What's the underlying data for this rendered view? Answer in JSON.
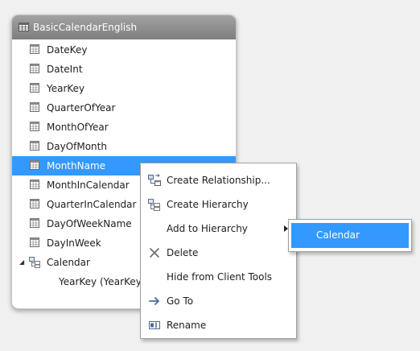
{
  "table": {
    "title": "BasicCalendarEnglish",
    "header_icon": "table-icon",
    "columns": [
      {
        "label": "DateKey",
        "icon": "column-icon"
      },
      {
        "label": "DateInt",
        "icon": "column-icon"
      },
      {
        "label": "YearKey",
        "icon": "column-icon"
      },
      {
        "label": "QuarterOfYear",
        "icon": "column-icon"
      },
      {
        "label": "MonthOfYear",
        "icon": "column-icon"
      },
      {
        "label": "DayOfMonth",
        "icon": "column-icon"
      },
      {
        "label": "MonthName",
        "icon": "column-icon",
        "selected": true
      },
      {
        "label": "MonthInCalendar",
        "icon": "column-icon"
      },
      {
        "label": "QuarterInCalendar",
        "icon": "column-icon"
      },
      {
        "label": "DayOfWeekName",
        "icon": "column-icon"
      },
      {
        "label": "DayInWeek",
        "icon": "column-icon"
      }
    ],
    "hierarchy": {
      "label": "Calendar",
      "icon": "hierarchy-icon",
      "expanded": true,
      "levels": [
        {
          "label": "YearKey (YearKey"
        }
      ]
    }
  },
  "context_menu": {
    "items": [
      {
        "label": "Create Relationship...",
        "icon": "relationship-icon"
      },
      {
        "label": "Create Hierarchy",
        "icon": "hierarchy-icon"
      },
      {
        "label": "Add to Hierarchy",
        "icon": "",
        "has_submenu": true
      },
      {
        "label": "Delete",
        "icon": "delete-icon"
      },
      {
        "label": "Hide from Client Tools",
        "icon": ""
      },
      {
        "label": "Go To",
        "icon": "arrow-right-icon"
      },
      {
        "label": "Rename",
        "icon": "rename-icon"
      }
    ]
  },
  "submenu": {
    "items": [
      {
        "label": "Calendar",
        "highlighted": true
      }
    ]
  },
  "colors": {
    "selection": "#3399ff",
    "header": "#8f8f8f",
    "background": "#f0f0f0"
  }
}
